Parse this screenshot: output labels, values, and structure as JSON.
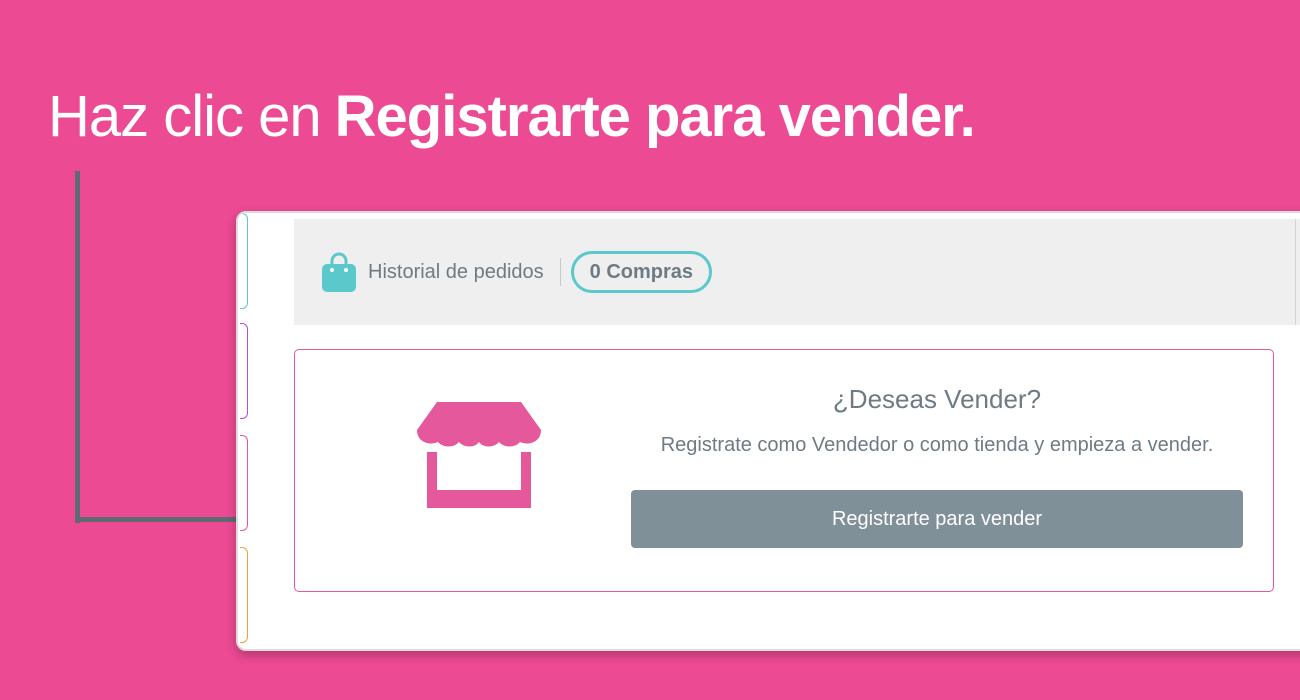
{
  "instruction": {
    "prefix": "Haz clic en",
    "emphasis": "Registrarte para vender."
  },
  "header": {
    "history_label": "Historial de pedidos",
    "purchases_badge": "0 Compras"
  },
  "sell_card": {
    "title": "¿Deseas Vender?",
    "subtitle": "Registrate como Vendedor o como tienda y empieza a vender.",
    "button_label": "Registrarte para vender"
  },
  "icons": {
    "header": "shopping-bag-icon",
    "card": "storefront-icon"
  },
  "colors": {
    "background": "#ec4a92",
    "accent_teal": "#5bc9cc",
    "accent_pink": "#e5589b",
    "button": "#7f9099",
    "text": "#6e7b84",
    "pointer": "#5f6a72"
  }
}
